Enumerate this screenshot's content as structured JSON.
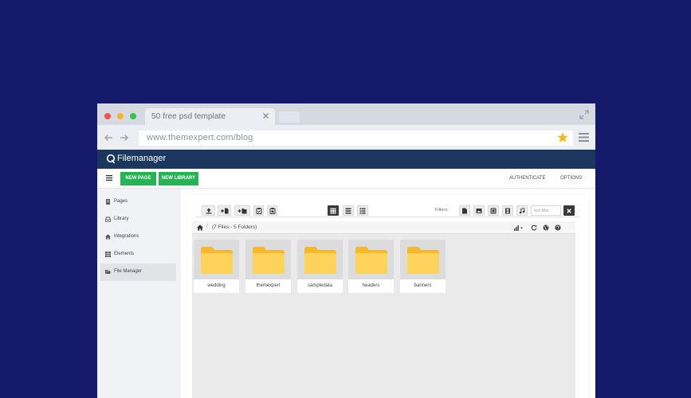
{
  "browser": {
    "tab_title": "50 free psd  template",
    "url": "www.themexpert.com/blog",
    "icons": [
      "close-icon",
      "expand-icon",
      "back-arrow-icon",
      "forward-arrow-icon",
      "star-icon",
      "menu-icon"
    ],
    "colors": {
      "close": "#f0524b",
      "minimize": "#f3b62a",
      "maximize": "#2fc44a",
      "star": "#f5b81c"
    }
  },
  "app": {
    "title": "Filemanager",
    "logo_icon": "q-logo-icon",
    "header_color": "#1c375d"
  },
  "toolbar": {
    "new_page": "NEW PAGE",
    "new_library": "NEW LIBRARY",
    "authenticate": "AUTHENTICATE",
    "options": "OPTIONS",
    "accent": "#25b356"
  },
  "sidebar": {
    "items": [
      {
        "label": "Pages",
        "icon": "pages-icon",
        "active": false
      },
      {
        "label": "Library",
        "icon": "library-icon",
        "active": false
      },
      {
        "label": "Integrations",
        "icon": "integrations-icon",
        "active": false
      },
      {
        "label": "Elements",
        "icon": "elements-icon",
        "active": false
      },
      {
        "label": "File Manager",
        "icon": "folder-open-icon",
        "active": true
      }
    ]
  },
  "filemanager": {
    "toolbar_icons": [
      "upload-icon",
      "add-file-icon",
      "add-folder-icon",
      "paste-icon",
      "clipboard-icon"
    ],
    "view_icons": [
      "grid-view-icon",
      "list-view-icon",
      "detail-view-icon"
    ],
    "filters_label": "Filters:",
    "filter_icons": [
      "filter-file-icon",
      "filter-image-icon",
      "filter-archive-icon",
      "filter-video-icon",
      "filter-audio-icon"
    ],
    "filter_placeholder": "text filter...",
    "path_summary": "(7 Files - 5 Folders)",
    "path_icons": [
      "home-icon",
      "sort-icon",
      "refresh-icon",
      "globe-icon",
      "help-icon"
    ],
    "folders": [
      {
        "name": "wedding"
      },
      {
        "name": "themexpert"
      },
      {
        "name": "sampledata"
      },
      {
        "name": "headers"
      },
      {
        "name": "banners"
      }
    ],
    "folder_color": "#fbc84a"
  }
}
